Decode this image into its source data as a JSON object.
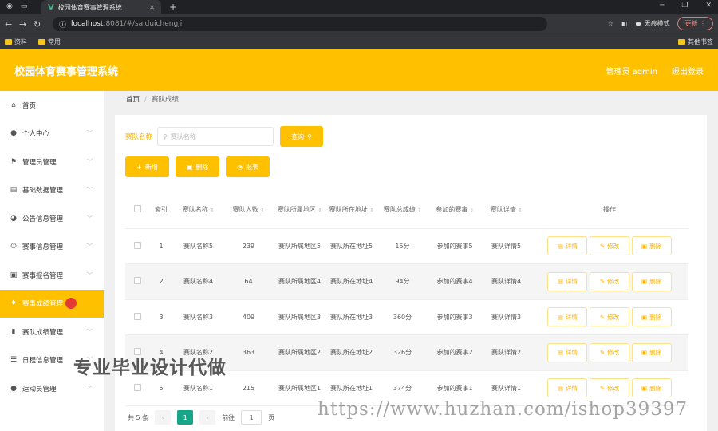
{
  "browser": {
    "tab_title": "校园体育赛事管理系统",
    "tab_logo": "V",
    "url_host": "localhost",
    "url_rest": ":8081/#/saiduichengji",
    "incognito_label": "无痕模式",
    "update_label": "更新",
    "bookmarks": [
      "资料",
      "常用"
    ],
    "other_bookmarks": "其他书签"
  },
  "header": {
    "title": "校园体育赛事管理系统",
    "user": "管理员 admin",
    "logout": "退出登录",
    "accent": "#ffc000"
  },
  "sidebar": {
    "items": [
      {
        "label": "首页",
        "icon": "home-icon"
      },
      {
        "label": "个人中心",
        "icon": "user-icon"
      },
      {
        "label": "管理员管理",
        "icon": "flag-icon"
      },
      {
        "label": "基础数据管理",
        "icon": "data-icon"
      },
      {
        "label": "公告信息管理",
        "icon": "notice-icon"
      },
      {
        "label": "赛事信息管理",
        "icon": "power-icon"
      },
      {
        "label": "赛事报名管理",
        "icon": "signup-icon"
      },
      {
        "label": "赛事成绩管理",
        "icon": "mic-icon"
      },
      {
        "label": "赛队成绩管理",
        "icon": "bar-chart-icon"
      },
      {
        "label": "日程信息管理",
        "icon": "list-icon"
      },
      {
        "label": "运动员管理",
        "icon": "athlete-icon"
      }
    ]
  },
  "breadcrumb": {
    "home": "首页",
    "current": "赛队成绩"
  },
  "search": {
    "label": "赛队名称",
    "placeholder": "赛队名称",
    "button": "查询"
  },
  "actions": {
    "add": "新增",
    "delete": "删除",
    "report": "报表"
  },
  "table": {
    "headers": {
      "index": "索引",
      "name": "赛队名称",
      "count": "赛队人数",
      "region": "赛队所属地区",
      "address": "赛队所在地址",
      "score": "赛队总成绩",
      "event": "参加的赛事",
      "detail": "赛队详情",
      "ops": "操作"
    },
    "rows": [
      {
        "index": "1",
        "name": "赛队名称5",
        "count": "239",
        "region": "赛队所属地区5",
        "address": "赛队所在地址5",
        "score": "15分",
        "event": "参加的赛事5",
        "detail": "赛队详情5"
      },
      {
        "index": "2",
        "name": "赛队名称4",
        "count": "64",
        "region": "赛队所属地区4",
        "address": "赛队所在地址4",
        "score": "94分",
        "event": "参加的赛事4",
        "detail": "赛队详情4"
      },
      {
        "index": "3",
        "name": "赛队名称3",
        "count": "409",
        "region": "赛队所属地区3",
        "address": "赛队所在地址3",
        "score": "360分",
        "event": "参加的赛事3",
        "detail": "赛队详情3"
      },
      {
        "index": "4",
        "name": "赛队名称2",
        "count": "363",
        "region": "赛队所属地区2",
        "address": "赛队所在地址2",
        "score": "326分",
        "event": "参加的赛事2",
        "detail": "赛队详情2"
      },
      {
        "index": "5",
        "name": "赛队名称1",
        "count": "215",
        "region": "赛队所属地区1",
        "address": "赛队所在地址1",
        "score": "374分",
        "event": "参加的赛事1",
        "detail": "赛队详情1"
      }
    ],
    "op_labels": {
      "detail": "详情",
      "edit": "修改",
      "delete": "删除"
    }
  },
  "pagination": {
    "total": "共 5 条",
    "page": "1",
    "goto": "前往",
    "page_input": "1",
    "page_suffix": "页"
  },
  "watermarks": {
    "line1": "专业毕业设计代做",
    "line2": "https://www.huzhan.com/ishop39397"
  }
}
